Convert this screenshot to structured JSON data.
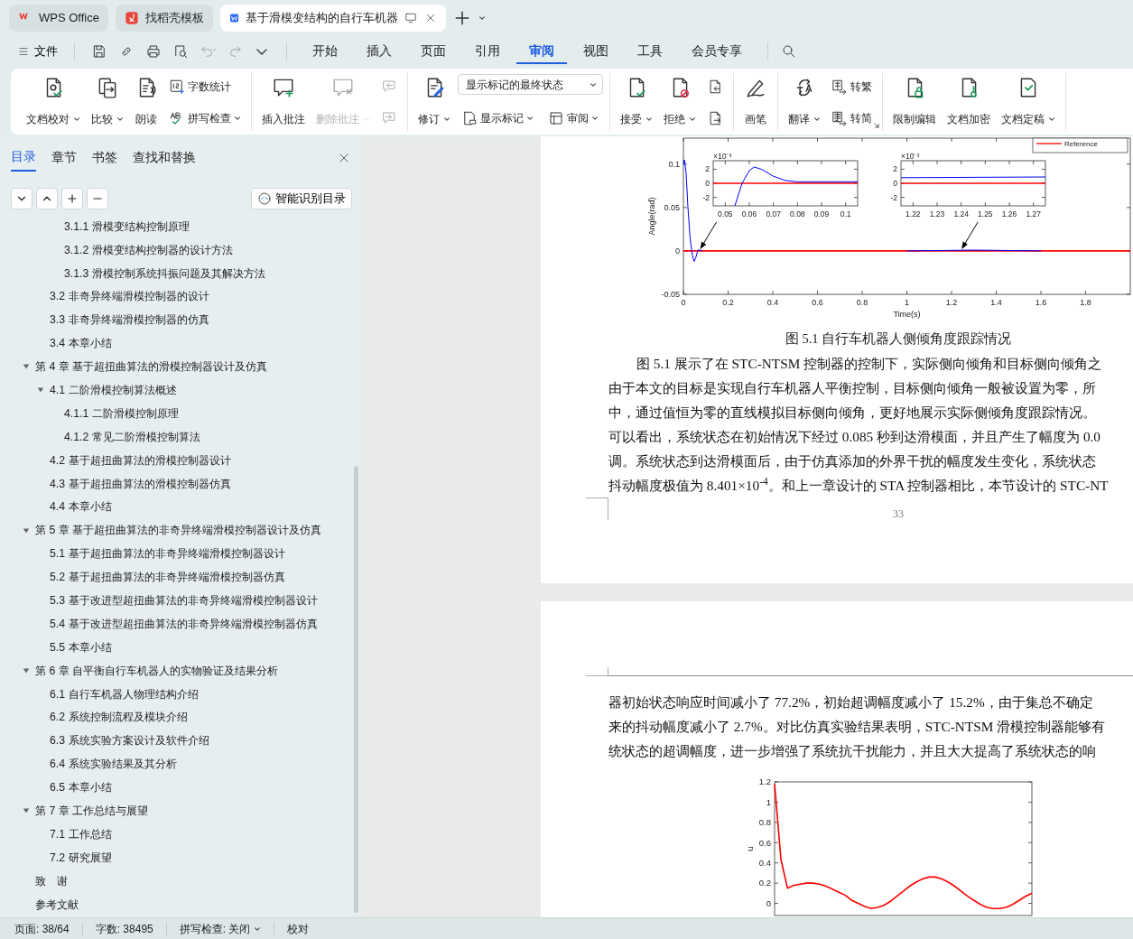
{
  "title_bar": {
    "tabs": [
      {
        "label": "WPS Office",
        "selected": false
      },
      {
        "label": "找稻壳模板",
        "selected": false
      },
      {
        "label": "基于滑模变结构的自行车机器",
        "selected": true
      }
    ]
  },
  "menu_bar": {
    "file_label": "文件",
    "quick_access": [
      {
        "disabled": false
      },
      {
        "disabled": false
      },
      {
        "disabled": false
      },
      {
        "disabled": false
      },
      {
        "disabled": true
      },
      {
        "disabled": true
      },
      {
        "disabled": false
      }
    ],
    "tabs": [
      {
        "label": "开始",
        "selected": false
      },
      {
        "label": "插入",
        "selected": false
      },
      {
        "label": "页面",
        "selected": false
      },
      {
        "label": "引用",
        "selected": false
      },
      {
        "label": "审阅",
        "selected": true
      },
      {
        "label": "视图",
        "selected": false
      },
      {
        "label": "工具",
        "selected": false
      },
      {
        "label": "会员专享",
        "selected": false
      }
    ]
  },
  "ribbon": {
    "groups": [
      {
        "launcher": false,
        "columns": [
          {
            "kind": "large",
            "label": "文档校对",
            "dropdown": true,
            "disabled": false
          },
          {
            "kind": "large",
            "label": "比较",
            "dropdown": true,
            "disabled": false
          },
          {
            "kind": "large",
            "label": "朗读",
            "dropdown": false,
            "disabled": false
          },
          {
            "kind": "stack",
            "rows": [
              [
                {
                  "kind": "button",
                  "label": "字数统计",
                  "dropdown": false,
                  "disabled": false
                }
              ],
              [
                {
                  "kind": "button",
                  "label": "拼写检查",
                  "dropdown": true,
                  "disabled": false
                }
              ]
            ]
          }
        ]
      },
      {
        "launcher": false,
        "columns": [
          {
            "kind": "large",
            "label": "插入批注",
            "dropdown": false,
            "disabled": false
          },
          {
            "kind": "large",
            "label": "删除批注",
            "dropdown": true,
            "disabled": true
          },
          {
            "kind": "stack",
            "rows": [
              [
                {
                  "kind": "button",
                  "dropdown": false,
                  "disabled": true
                }
              ],
              [
                {
                  "kind": "button",
                  "dropdown": false,
                  "disabled": true
                }
              ]
            ]
          }
        ]
      },
      {
        "launcher": false,
        "columns": [
          {
            "kind": "large",
            "label": "修订",
            "dropdown": true,
            "disabled": false
          },
          {
            "kind": "stack",
            "rows": [
              [
                {
                  "kind": "select",
                  "value": "显示标记的最终状态"
                }
              ],
              [
                {
                  "kind": "button",
                  "label": "显示标记",
                  "dropdown": true,
                  "disabled": false
                },
                {
                  "kind": "button",
                  "label": "审阅",
                  "dropdown": true,
                  "disabled": false
                }
              ]
            ]
          }
        ]
      },
      {
        "launcher": false,
        "columns": [
          {
            "kind": "large",
            "label": "接受",
            "dropdown": true,
            "disabled": false
          },
          {
            "kind": "large",
            "label": "拒绝",
            "dropdown": true,
            "disabled": false
          },
          {
            "kind": "stack",
            "rows": [
              [
                {
                  "kind": "button",
                  "dropdown": false,
                  "disabled": false
                }
              ],
              [
                {
                  "kind": "button",
                  "dropdown": false,
                  "disabled": false
                }
              ]
            ]
          }
        ]
      },
      {
        "launcher": false,
        "columns": [
          {
            "kind": "large",
            "label": "画笔",
            "dropdown": false,
            "disabled": false
          }
        ]
      },
      {
        "launcher": true,
        "columns": [
          {
            "kind": "large",
            "label": "翻译",
            "dropdown": true,
            "disabled": false
          },
          {
            "kind": "stack",
            "rows": [
              [
                {
                  "kind": "button",
                  "label": "转繁",
                  "dropdown": false,
                  "disabled": false
                }
              ],
              [
                {
                  "kind": "button",
                  "label": "转简",
                  "dropdown": false,
                  "disabled": false
                }
              ]
            ]
          }
        ]
      },
      {
        "launcher": false,
        "columns": [
          {
            "kind": "large",
            "label": "限制编辑",
            "dropdown": false,
            "disabled": false
          },
          {
            "kind": "large",
            "label": "文档加密",
            "dropdown": false,
            "disabled": false
          },
          {
            "kind": "large",
            "label": "文档定稿",
            "dropdown": true,
            "disabled": false
          }
        ]
      }
    ]
  },
  "sidebar": {
    "tabs": [
      {
        "label": "目录",
        "selected": true
      },
      {
        "label": "章节",
        "selected": false
      },
      {
        "label": "书签",
        "selected": false
      },
      {
        "label": "查找和替换",
        "selected": false
      }
    ],
    "smart_button": "智能识别目录",
    "toc": [
      {
        "children": [
          {
            "children": [
              {
                "label": "3.1.1 滑模变结构控制原理"
              },
              {
                "label": "3.1.2 滑模变结构控制器的设计方法"
              },
              {
                "label": "3.1.3 滑模控制系统抖振问题及其解决方法"
              }
            ]
          },
          {
            "label": "3.2 非奇异终端滑模控制器的设计"
          },
          {
            "label": "3.3 非奇异终端滑模控制器的仿真"
          },
          {
            "label": "3.4 本章小结"
          }
        ]
      },
      {
        "label": "第 4 章 基于超扭曲算法的滑模控制器设计及仿真",
        "expanded": true,
        "children": [
          {
            "label": "4.1 二阶滑模控制算法概述",
            "expanded": true,
            "children": [
              {
                "label": "4.1.1 二阶滑模控制原理"
              },
              {
                "label": "4.1.2 常见二阶滑模控制算法"
              }
            ]
          },
          {
            "label": "4.2 基于超扭曲算法的滑模控制器设计"
          },
          {
            "label": "4.3 基于超扭曲算法的滑模控制器仿真"
          },
          {
            "label": "4.4 本章小结"
          }
        ]
      },
      {
        "label": "第 5 章 基于超扭曲算法的非奇异终端滑模控制器设计及仿真",
        "expanded": true,
        "children": [
          {
            "label": "5.1 基于超扭曲算法的非奇异终端滑模控制器设计"
          },
          {
            "label": "5.2 基于超扭曲算法的非奇异终端滑模控制器仿真"
          },
          {
            "label": "5.3 基于改进型超扭曲算法的非奇异终端滑模控制器设计"
          },
          {
            "label": "5.4 基于改进型超扭曲算法的非奇异终端滑模控制器仿真"
          },
          {
            "label": "5.5 本章小结"
          }
        ]
      },
      {
        "label": "第 6 章 自平衡自行车机器人的实物验证及结果分析",
        "expanded": true,
        "children": [
          {
            "label": "6.1 自行车机器人物理结构介绍"
          },
          {
            "label": "6.2 系统控制流程及模块介绍"
          },
          {
            "label": "6.3 系统实验方案设计及软件介绍"
          },
          {
            "label": "6.4 系统实验结果及其分析"
          },
          {
            "label": "6.5 本章小结"
          }
        ]
      },
      {
        "label": "第 7 章 工作总结与展望",
        "expanded": true,
        "children": [
          {
            "label": "7.1 工作总结"
          },
          {
            "label": "7.2 研究展望"
          }
        ]
      },
      {
        "label": "致　谢"
      },
      {
        "label": "参考文献"
      }
    ]
  },
  "document": {
    "pages": [
      {
        "blocks": [
          {
            "kind": "figure",
            "chart_data": {
              "type": "line",
              "xlabel": "Time(s)",
              "ylabel": "Angle(rad)",
              "xlim": [
                0,
                2
              ],
              "ylim": [
                -0.05,
                0.13
              ],
              "xticks": [
                0,
                0.2,
                0.4,
                0.6,
                0.8,
                1,
                1.2,
                1.4,
                1.6,
                1.8
              ],
              "yticks": [
                -0.05,
                0,
                0.05,
                0.1
              ],
              "series": [
                {
                  "color": "#0000ff",
                  "x": [
                    0,
                    0.005,
                    0.012,
                    0.02,
                    0.03,
                    0.04,
                    0.048,
                    0.055,
                    0.065,
                    0.075,
                    0.085,
                    0.1,
                    0.5,
                    1.0,
                    1.3,
                    1.6
                  ],
                  "values": [
                    0.1,
                    0.105,
                    0.09,
                    0.05,
                    0.015,
                    -0.005,
                    -0.012,
                    -0.008,
                    0.001,
                    0.001,
                    0,
                    null,
                    null,
                    0,
                    0.001,
                    0
                  ]
                },
                {
                  "name": "Reference",
                  "color": "#ff0000",
                  "x": [
                    0,
                    2
                  ],
                  "values": [
                    0,
                    0
                  ]
                }
              ]
            },
            "insets": [
              {
                "chart_data": {
                  "type": "line",
                  "xlim": [
                    0.045,
                    0.105
                  ],
                  "ylim": [
                    -3.2,
                    3.2
                  ],
                  "xticks": [
                    0.05,
                    0.06,
                    0.07,
                    0.08,
                    0.09,
                    0.1
                  ],
                  "yticks": [
                    -2,
                    0,
                    2
                  ],
                  "annotations": [
                    {
                      "text": "×10⁻³"
                    }
                  ],
                  "series": [
                    {
                      "color": "#0000ff",
                      "x": [
                        0.054,
                        0.057,
                        0.06,
                        0.062,
                        0.065,
                        0.07,
                        0.075,
                        0.08,
                        0.09,
                        0.105
                      ],
                      "values": [
                        -3.2,
                        0,
                        1.8,
                        2.3,
                        2.0,
                        1.0,
                        0.4,
                        0.2,
                        0.2,
                        0.2
                      ]
                    },
                    {
                      "color": "#ff0000",
                      "x": [
                        0.045,
                        0.105
                      ],
                      "values": [
                        0,
                        0
                      ]
                    }
                  ]
                }
              },
              {
                "chart_data": {
                  "type": "line",
                  "xlim": [
                    1.215,
                    1.275
                  ],
                  "ylim": [
                    -3.2,
                    3.2
                  ],
                  "xticks": [
                    1.22,
                    1.23,
                    1.24,
                    1.25,
                    1.26,
                    1.27
                  ],
                  "yticks": [
                    -2,
                    0,
                    2
                  ],
                  "annotations": [
                    {
                      "text": "×10⁻³"
                    }
                  ],
                  "series": [
                    {
                      "color": "#0000ff",
                      "x": [
                        1.215,
                        1.275
                      ],
                      "values": [
                        0.8,
                        0.9
                      ]
                    },
                    {
                      "color": "#ff0000",
                      "x": [
                        1.215,
                        1.275
                      ],
                      "values": [
                        0,
                        0
                      ]
                    }
                  ]
                }
              }
            ]
          },
          {
            "kind": "caption",
            "text": "图 5.1  自行车机器人侧倾角度跟踪情况"
          },
          {
            "kind": "paragraph",
            "first_line_indent": true,
            "lines": [
              "图 5.1 展示了在 STC-NTSM 控制器的控制下，实际侧向倾角和目标侧向倾角之",
              "由于本文的目标是实现自行车机器人平衡控制，目标侧向倾角一般被设置为零，所",
              "中，通过值恒为零的直线模拟目标侧向倾角，更好地展示实际侧倾角度跟踪情况。",
              "可以看出，系统状态在初始情况下经过 0.085 秒到达滑模面，并且产生了幅度为 0.0",
              "调。系统状态到达滑模面后，由于仿真添加的外界干扰的幅度发生变化，系统状态",
              "抖动幅度极值为 8.401×10$^{-4}$。和上一章设计的 STA 控制器相比，本节设计的 STC-NT"
            ]
          },
          {
            "kind": "page_footer",
            "text": "33"
          }
        ]
      },
      {
        "blocks": [
          {
            "kind": "page_header"
          },
          {
            "kind": "paragraph",
            "first_line_indent": false,
            "lines": [
              "器初始状态响应时间减小了 77.2%，初始超调幅度减小了 15.2%，由于集总不确定",
              "来的抖动幅度减小了 2.7%。对比仿真实验结果表明，STC-NTSM 滑模控制器能够有",
              "统状态的超调幅度，进一步增强了系统抗干扰能力，并且大大提高了系统状态的响"
            ]
          },
          {
            "kind": "figure",
            "chart_data": {
              "type": "line",
              "ylabel": "u",
              "ylim": [
                -0.12,
                1.2
              ],
              "yticks": [
                0,
                0.2,
                0.4,
                0.6,
                0.8,
                1,
                1.2
              ],
              "categories": [
                null,
                null,
                null,
                null,
                null,
                null,
                null,
                null,
                null,
                null,
                null,
                null,
                null,
                null,
                null,
                null,
                null,
                null,
                null,
                null,
                null,
                null,
                null,
                null,
                null,
                null,
                null,
                null,
                null,
                null,
                null,
                null,
                null,
                null,
                null,
                null,
                null,
                null,
                null,
                null,
                null
              ],
              "series": [
                {
                  "color": "#ff0000",
                  "values": [
                    1.18,
                    0.43,
                    0.15,
                    0.18,
                    0.19,
                    0.2,
                    0.2,
                    0.19,
                    0.17,
                    0.14,
                    0.11,
                    0.08,
                    0.03,
                    0,
                    -0.03,
                    -0.05,
                    -0.04,
                    -0.02,
                    0.02,
                    0.07,
                    0.12,
                    0.17,
                    0.21,
                    0.24,
                    0.26,
                    0.26,
                    0.24,
                    0.21,
                    0.17,
                    0.12,
                    0.07,
                    0.03,
                    -0.01,
                    -0.04,
                    -0.05,
                    -0.05,
                    -0.04,
                    -0.01,
                    0.03,
                    0.07,
                    0.1
                  ]
                }
              ]
            }
          }
        ]
      }
    ]
  },
  "status_bar": {
    "items": [
      {
        "label": "页面: 38/64",
        "dropdown": false
      },
      {
        "label": "字数: 38495",
        "dropdown": false
      },
      {
        "label": "拼写检查: 关闭",
        "dropdown": true
      },
      {
        "label": "校对",
        "dropdown": false
      }
    ]
  }
}
